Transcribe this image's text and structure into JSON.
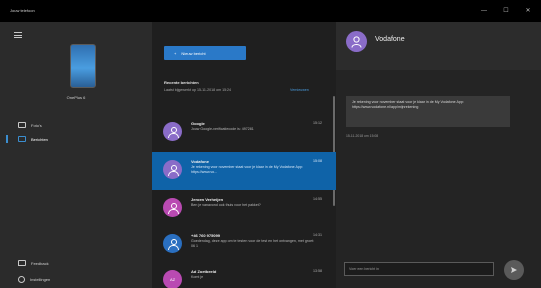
{
  "window": {
    "title": "Jouw telefoon",
    "controls": {
      "minimize": "—",
      "maximize": "☐",
      "close": "✕"
    }
  },
  "sidebar": {
    "device_name": "OnePlus 6",
    "nav": [
      {
        "label": "Foto's",
        "icon": "photos-icon"
      },
      {
        "label": "Berichten",
        "icon": "messages-icon",
        "active": true
      }
    ],
    "footer": [
      {
        "label": "Feedback",
        "icon": "feedback-icon"
      },
      {
        "label": "Instellingen",
        "icon": "settings-icon"
      }
    ]
  },
  "messages": {
    "new_button": "Nieuw bericht",
    "recent_title": "Recente berichten",
    "recent_subtitle": "Laatst bijgewerkt op 15-11-2018 om 15:24",
    "refresh_link": "Vernieuwen",
    "conversations": [
      {
        "name": "Google",
        "time": "15:12",
        "preview": "Jouw Google-verificatiecode is: 497281",
        "avatar": "person",
        "avatar_color": "#8a6cc8"
      },
      {
        "name": "Vodafone",
        "time": "15:08",
        "preview": "Je rekening voor november staat voor je klaar in de My Vodafone App: https://www.vo...",
        "avatar": "person",
        "avatar_color": "#8a6cc8",
        "selected": true
      },
      {
        "name": "Jeroen Verheijen",
        "time": "14:55",
        "preview": "Ben je vanavond ook thuis voor het pakket?",
        "avatar": "person",
        "avatar_color": "#b94ab2"
      },
      {
        "name": "+46 760 975099",
        "time": "14:31",
        "preview": "Goedendag, deze app om te testen voor de test en het ontvangen, met groet: 06 1",
        "avatar": "person",
        "avatar_color": "#2a6fc0"
      },
      {
        "name": "Ad Zoetbeeld",
        "time": "13:58",
        "preview": "Komt je",
        "avatar": "initials",
        "avatar_text": "AZ",
        "avatar_color": "#b94ab2"
      }
    ]
  },
  "detail": {
    "contact_name": "Vodafone",
    "message": "Je rekening voor november staat voor je klaar in de My Vodafone App: https://www.vodafone.nl/app/mijnrekening",
    "message_time": "15-11-2018 om 15:08",
    "compose_placeholder": "Voer een bericht in",
    "send_icon": "send-icon"
  }
}
